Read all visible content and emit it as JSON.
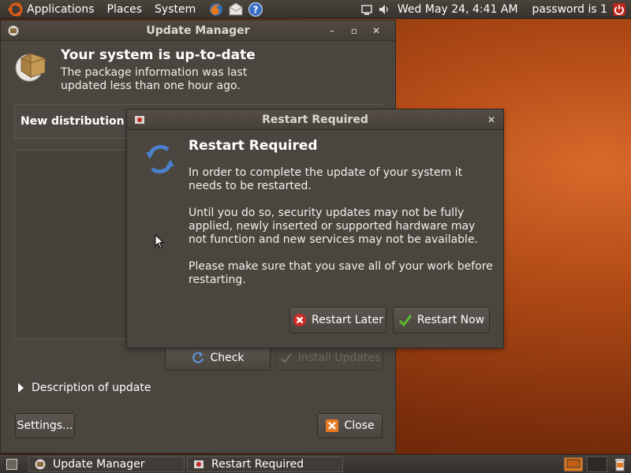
{
  "top_panel": {
    "menus": [
      "Applications",
      "Places",
      "System"
    ],
    "launchers": [
      "firefox-icon",
      "mail-icon",
      "help-icon"
    ],
    "clock": "Wed May 24,  4:41 AM",
    "user": "password is 1"
  },
  "update_manager": {
    "title": "Update Manager",
    "header_title": "Your system is up-to-date",
    "header_desc": "The package information was last updated less than one hour ago.",
    "distribution_text": "New distribution r",
    "check_label": "Check",
    "install_label": "Install Updates",
    "description_label": "Description of update",
    "settings_label": "Settings...",
    "close_label": "Close"
  },
  "dialog": {
    "title": "Restart Required",
    "heading": "Restart Required",
    "para1": "In order to complete the update of your system it needs to be restarted.",
    "para2": "Until you do so, security updates may not be fully applied, newly inserted or supported hardware may not function and new services may not be available.",
    "para3": "Please make sure that you save all of your work before restarting.",
    "later_label": "Restart Later",
    "now_label": "Restart Now"
  },
  "taskbar": {
    "items": [
      "Update Manager",
      "Restart Required"
    ]
  }
}
